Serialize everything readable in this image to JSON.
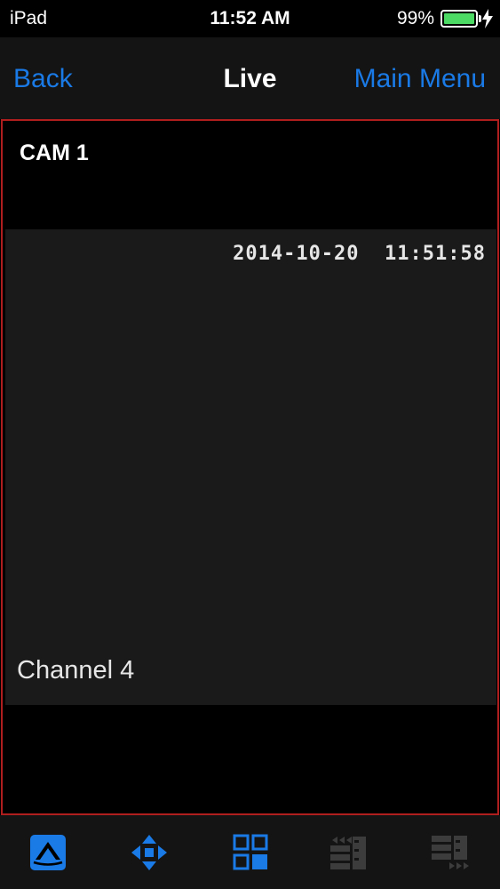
{
  "status_bar": {
    "carrier": "iPad",
    "time": "11:52 AM",
    "battery_percent": "99%",
    "battery_level": 0.99
  },
  "nav": {
    "back_label": "Back",
    "title": "Live",
    "menu_label": "Main Menu"
  },
  "video": {
    "camera_label": "CAM 1",
    "osd_timestamp": "2014-10-20  11:51:58",
    "osd_channel": "Channel 4"
  },
  "toolbar": {
    "items": [
      {
        "icon": "live-view-icon",
        "active": true
      },
      {
        "icon": "ptz-arrows-icon",
        "active": true
      },
      {
        "icon": "grid-layout-icon",
        "active": true
      },
      {
        "icon": "rewind-playback-icon",
        "active": false
      },
      {
        "icon": "forward-playback-icon",
        "active": false
      }
    ]
  },
  "colors": {
    "accent": "#1a7ae6",
    "panel_border": "#b01e1e",
    "battery": "#4cd964",
    "disabled": "#3c3c3c"
  }
}
